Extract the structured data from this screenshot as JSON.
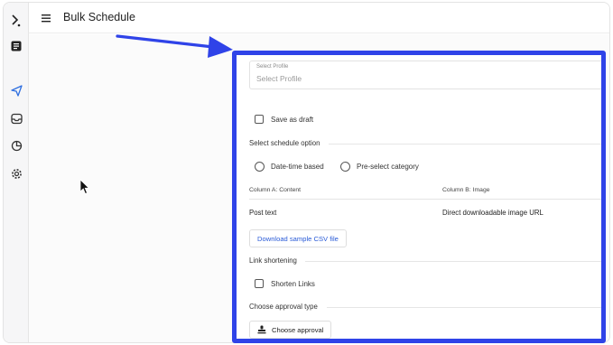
{
  "app": {
    "title": "Bulk Schedule",
    "rail_icons": [
      "logo-icon",
      "dashboard-icon",
      "send-icon",
      "inbox-icon",
      "analytics-icon",
      "settings-icon"
    ]
  },
  "form": {
    "profile": {
      "label": "Select Profile",
      "placeholder": "Select Profile"
    },
    "draft_label": "Save as draft",
    "schedule_option_title": "Select schedule option",
    "schedule_options": [
      "Date-time based",
      "Pre-select category"
    ],
    "columns": {
      "a_header": "Column A: Content",
      "b_header": "Column B: Image",
      "a_value": "Post text",
      "b_value": "Direct downloadable image URL"
    },
    "download_button": "Download sample CSV file",
    "link_shortening_title": "Link shortening",
    "shorten_links_label": "Shorten Links",
    "approval_title": "Choose approval type",
    "approval_button": "Choose approval"
  },
  "colors": {
    "highlight": "#2f43e8",
    "link": "#2a5bd7"
  }
}
